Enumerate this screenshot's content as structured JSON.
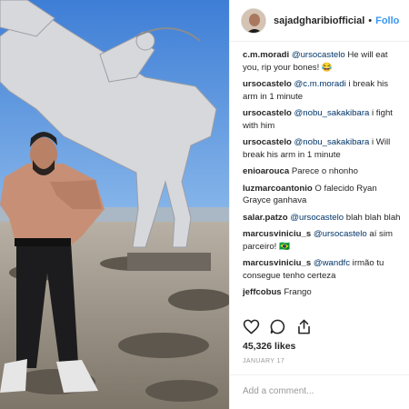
{
  "post": {
    "username": "sajadgharibiofficial",
    "separator": "•",
    "follow_label": "Follo"
  },
  "comments": [
    {
      "user": "c.m.moradi",
      "mention": "@ursocastelo",
      "text": " He will eat you, rip your bones! 😂"
    },
    {
      "user": "ursocastelo",
      "mention": "@c.m.moradi",
      "text": " i break his arm in 1 minute"
    },
    {
      "user": "ursocastelo",
      "mention": "@nobu_sakakibara",
      "text": " i fight with him"
    },
    {
      "user": "ursocastelo",
      "mention": "@nobu_sakakibara",
      "text": " i Will break his arm in 1 minute"
    },
    {
      "user": "enioarouca",
      "mention": "",
      "text": " Parece o nhonho"
    },
    {
      "user": "luzmarcoantonio",
      "mention": "",
      "text": " O falecido Ryan Grayce ganhava"
    },
    {
      "user": "salar.patzo",
      "mention": "@ursocastelo",
      "text": " blah blah blah"
    },
    {
      "user": "marcusviniciu_s",
      "mention": "@ursocastelo",
      "text": " aí sim parceiro! 🇧🇷"
    },
    {
      "user": "marcusviniciu_s",
      "mention": "@wandfc",
      "text": " irmão tu consegue tenho certeza"
    },
    {
      "user": "jeffcobus",
      "mention": "",
      "text": " Frango"
    }
  ],
  "icons": {
    "like": "heart-icon",
    "comment": "comment-icon",
    "share": "share-icon"
  },
  "likes": "45,326 likes",
  "date": "JANUARY 17",
  "add_comment_placeholder": "Add a comment..."
}
